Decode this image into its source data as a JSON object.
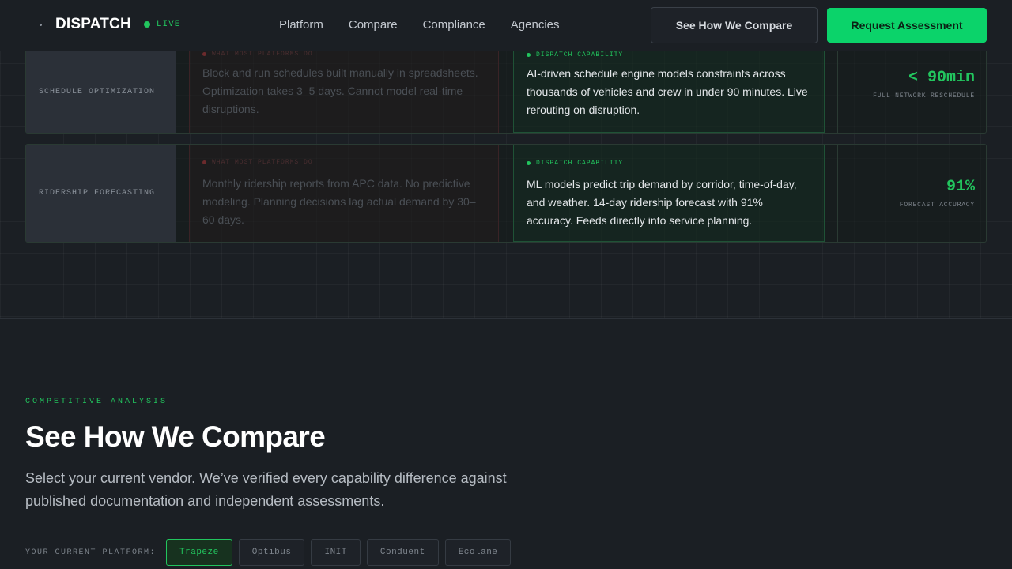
{
  "header": {
    "brand": "DISPATCH",
    "live": "LIVE",
    "nav": [
      "Platform",
      "Compare",
      "Compliance",
      "Agencies"
    ],
    "compare_button": "See How We Compare",
    "cta_button": "Request Assessment"
  },
  "rows": [
    {
      "label": "SCHEDULE OPTIMIZATION",
      "old_tag": "WHAT MOST PLATFORMS DO",
      "old_text": "Block and run schedules built manually in spreadsheets. Optimization takes 3–5 days. Cannot model real-time disruptions.",
      "new_tag": "DISPATCH CAPABILITY",
      "new_text": "AI-driven schedule engine models constraints across thousands of vehicles and crew in under 90 minutes. Live rerouting on disruption.",
      "metric_value": "< 90min",
      "metric_label": "FULL NETWORK RESCHEDULE"
    },
    {
      "label": "RIDERSHIP FORECASTING",
      "old_tag": "WHAT MOST PLATFORMS DO",
      "old_text": "Monthly ridership reports from APC data. No predictive modeling. Planning decisions lag actual demand by 30–60 days.",
      "new_tag": "DISPATCH CAPABILITY",
      "new_text": "ML models predict trip demand by corridor, time-of-day, and weather. 14-day ridership forecast with 91% accuracy. Feeds directly into service planning.",
      "metric_value": "91%",
      "metric_label": "FORECAST ACCURACY"
    }
  ],
  "compare": {
    "eyebrow": "COMPETITIVE ANALYSIS",
    "title": "See How We Compare",
    "description": "Select your current vendor. We’ve verified every capability difference against published documentation and independent assessments.",
    "vendor_label": "YOUR CURRENT PLATFORM:",
    "vendors": [
      "Trapeze",
      "Optibus",
      "INIT",
      "Conduent",
      "Ecolane"
    ],
    "selected_vendor": "Trapeze"
  },
  "colors": {
    "accent": "#22c55e",
    "cta": "#0bd36a",
    "background": "#1b1f24"
  }
}
